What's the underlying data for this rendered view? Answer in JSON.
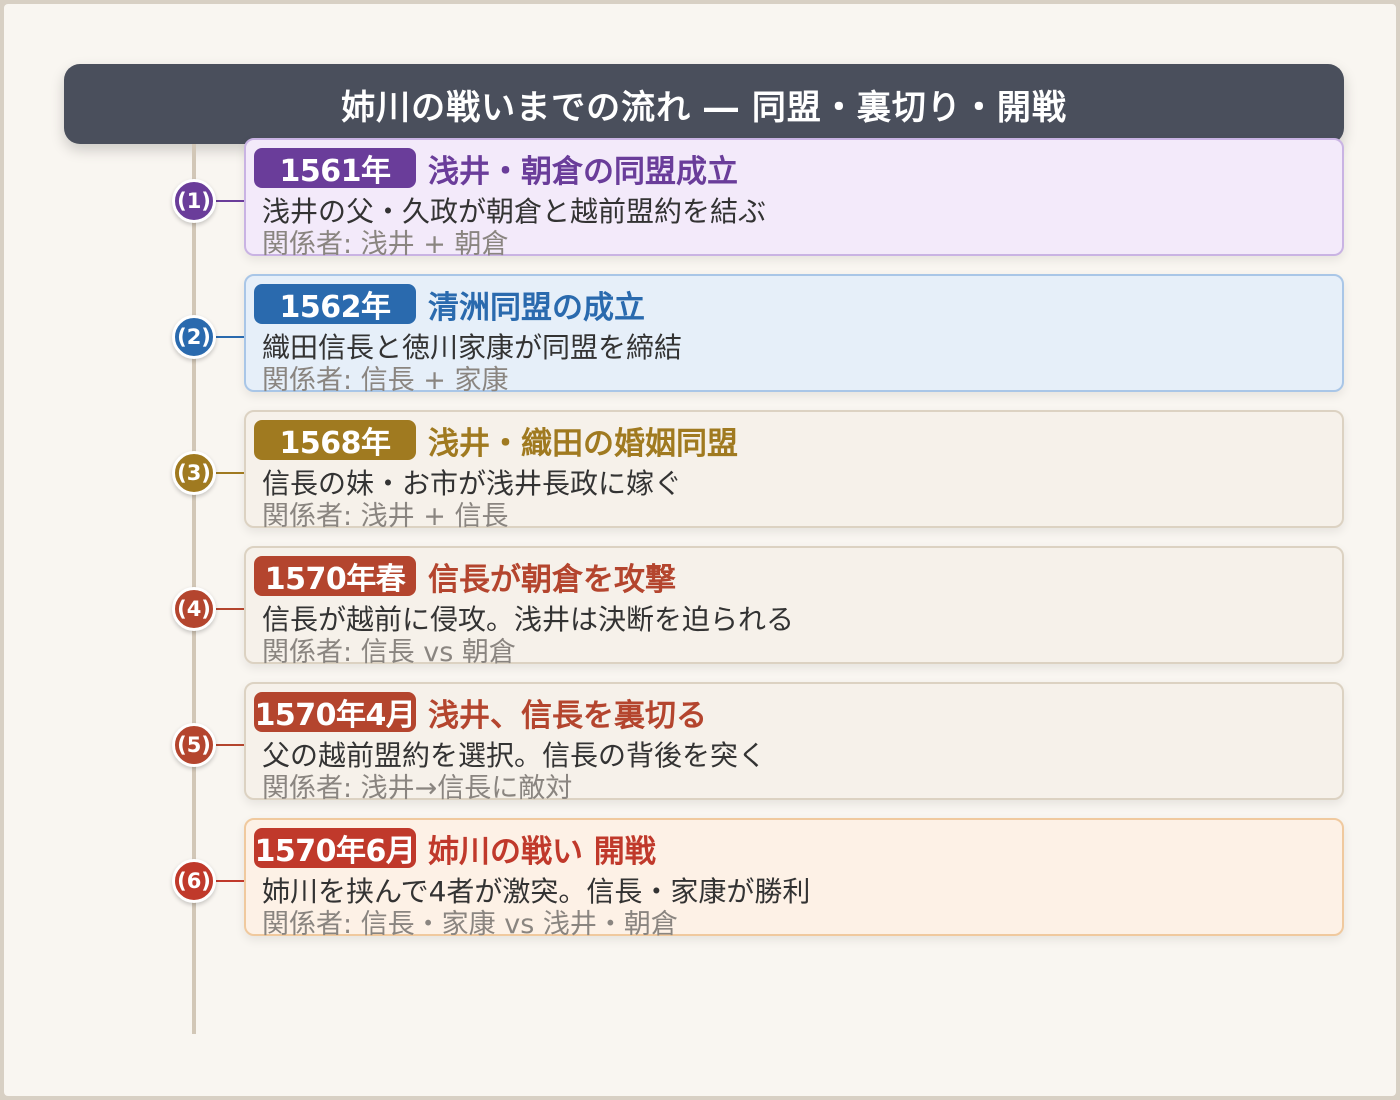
{
  "title": "姉川の戦いまでの流れ ― 同盟・裏切り・開戦",
  "events": [
    {
      "marker": "(1)",
      "date": "1561年",
      "title": "浅井・朝倉の同盟成立",
      "description": "浅井の父・久政が朝倉と越前盟約を結ぶ",
      "parties": "関係者: 浅井 + 朝倉",
      "color": "#6a3d9a",
      "bg": "#f3eafa",
      "border": "#c9b3e3"
    },
    {
      "marker": "(2)",
      "date": "1562年",
      "title": "清洲同盟の成立",
      "description": "織田信長と徳川家康が同盟を締結",
      "parties": "関係者: 信長 + 家康",
      "color": "#2a6aae",
      "bg": "#e6eff9",
      "border": "#a9c6e7"
    },
    {
      "marker": "(3)",
      "date": "1568年",
      "title": "浅井・織田の婚姻同盟",
      "description": "信長の妹・お市が浅井長政に嫁ぐ",
      "parties": "関係者: 浅井 + 信長",
      "color": "#a07a20",
      "bg": "#f6f1ea",
      "border": "#dcd2c2"
    },
    {
      "marker": "(4)",
      "date": "1570年春",
      "title": "信長が朝倉を攻撃",
      "description": "信長が越前に侵攻。浅井は決断を迫られる",
      "parties": "関係者: 信長 vs 朝倉",
      "color": "#b4452e",
      "bg": "#f6f1ea",
      "border": "#dcd2c2"
    },
    {
      "marker": "(5)",
      "date": "1570年4月",
      "title": "浅井、信長を裏切る",
      "description": "父の越前盟約を選択。信長の背後を突く",
      "parties": "関係者: 浅井→信長に敵対",
      "color": "#b4452e",
      "bg": "#f6f1ea",
      "border": "#dcd2c2"
    },
    {
      "marker": "(6)",
      "date": "1570年6月",
      "title": "姉川の戦い 開戦",
      "description": "姉川を挟んで4者が激突。信長・家康が勝利",
      "parties": "関係者: 信長・家康 vs 浅井・朝倉",
      "color": "#c0392b",
      "bg": "#fdf1e6",
      "border": "#f0c99e"
    }
  ]
}
